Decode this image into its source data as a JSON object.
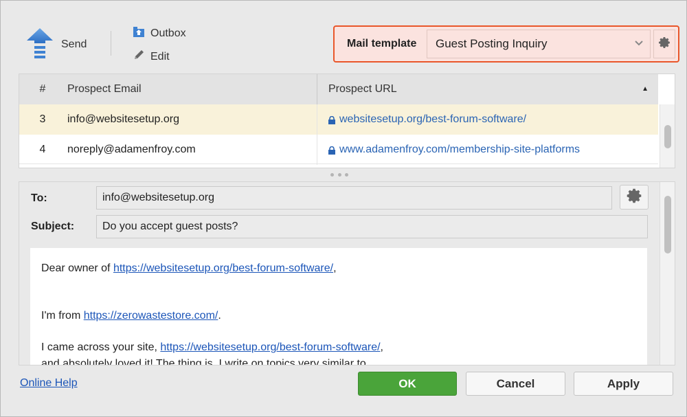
{
  "toolbar": {
    "send_label": "Send",
    "outbox_label": "Outbox",
    "edit_label": "Edit"
  },
  "mail_template": {
    "label": "Mail template",
    "selected": "Guest Posting Inquiry"
  },
  "table": {
    "columns": [
      "#",
      "Prospect Email",
      "Prospect URL"
    ],
    "rows": [
      {
        "num": "3",
        "email": "info@websitesetup.org",
        "url": "websitesetup.org/best-forum-software/",
        "selected": true
      },
      {
        "num": "4",
        "email": "noreply@adamenfroy.com",
        "url": "www.adamenfroy.com/membership-site-platforms",
        "selected": false
      }
    ]
  },
  "message": {
    "to_label": "To:",
    "to_value": "info@websitesetup.org",
    "subject_label": "Subject:",
    "subject_value": "Do you accept guest posts?",
    "body": {
      "line1_prefix": "Dear owner of ",
      "line1_link": "https://websitesetup.org/best-forum-software/",
      "line1_suffix": ",",
      "line2_prefix": "I'm  from ",
      "line2_link": "https://zerowastestore.com/",
      "line2_suffix": ".",
      "line3_prefix": "I came across your site, ",
      "line3_link": "https://websitesetup.org/best-forum-software/",
      "line3_suffix": ",",
      "line4": "and absolutely loved it! The thing is, I write on topics very similar to"
    }
  },
  "footer": {
    "help_link": "Online Help",
    "ok_label": "OK",
    "cancel_label": "Cancel",
    "apply_label": "Apply"
  },
  "colors": {
    "accent_orange": "#e9562a",
    "ok_green": "#4aa43a",
    "link_blue": "#1b55b8",
    "selected_row": "#f9f2da"
  }
}
